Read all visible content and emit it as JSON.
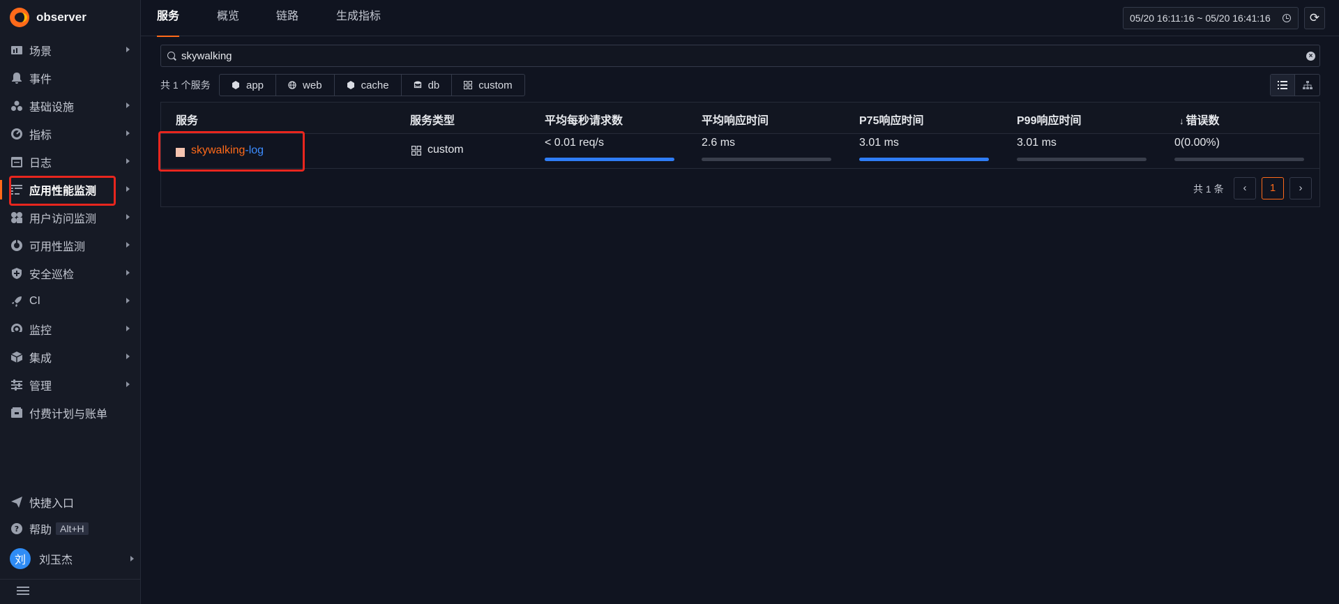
{
  "app": {
    "name": "observer"
  },
  "sidebar": {
    "items": [
      {
        "label": "场景",
        "icon": "dashboard-icon",
        "expandable": true
      },
      {
        "label": "事件",
        "icon": "bell-icon",
        "expandable": false
      },
      {
        "label": "基础设施",
        "icon": "infrastructure-icon",
        "expandable": true
      },
      {
        "label": "指标",
        "icon": "metrics-icon",
        "expandable": true
      },
      {
        "label": "日志",
        "icon": "log-icon",
        "expandable": true
      },
      {
        "label": "应用性能监测",
        "icon": "apm-icon",
        "expandable": true,
        "active": true
      },
      {
        "label": "用户访问监测",
        "icon": "rum-icon",
        "expandable": true
      },
      {
        "label": "可用性监测",
        "icon": "availability-icon",
        "expandable": true
      },
      {
        "label": "安全巡检",
        "icon": "shield-icon",
        "expandable": true
      },
      {
        "label": "CI",
        "icon": "rocket-icon",
        "expandable": true
      },
      {
        "label": "监控",
        "icon": "monitor-icon",
        "expandable": true
      },
      {
        "label": "集成",
        "icon": "integration-icon",
        "expandable": true
      },
      {
        "label": "管理",
        "icon": "settings-sliders-icon",
        "expandable": true
      },
      {
        "label": "付费计划与账单",
        "icon": "billing-icon",
        "expandable": false
      }
    ],
    "bottom": {
      "shortcut_label": "快捷入口",
      "help_label": "帮助",
      "help_shortcut": "Alt+H",
      "user_avatar": "刘",
      "user_name": "刘玉杰"
    }
  },
  "header": {
    "tabs": [
      "服务",
      "概览",
      "链路",
      "生成指标"
    ],
    "active_tab": "服务",
    "time_range": "05/20 16:11:16 ~ 05/20 16:41:16"
  },
  "search": {
    "value": "skywalking"
  },
  "filters": {
    "count_text": "共 1 个服务",
    "types": [
      {
        "label": "app",
        "icon": "app-icon"
      },
      {
        "label": "web",
        "icon": "globe-icon"
      },
      {
        "label": "cache",
        "icon": "cache-icon"
      },
      {
        "label": "db",
        "icon": "database-icon"
      },
      {
        "label": "custom",
        "icon": "custom-icon"
      }
    ]
  },
  "table": {
    "columns": [
      "服务",
      "服务类型",
      "平均每秒请求数",
      "平均响应时间",
      "P75响应时间",
      "P99响应时间",
      "错误数"
    ],
    "sort_indicator": "↓",
    "rows": [
      {
        "service_part1": "skywalking",
        "service_part2": "-log",
        "type": "custom",
        "avg_rps": "< 0.01 req/s",
        "avg_rps_bar": 1.0,
        "avg_resp": "2.6 ms",
        "avg_resp_bar": 0.0,
        "p75": "3.01 ms",
        "p75_bar": 1.0,
        "p99": "3.01 ms",
        "p99_bar": 0.0,
        "errors": "0(0.00%)",
        "errors_bar": 0.0
      }
    ],
    "pagination": {
      "total_text": "共 1 条",
      "current_page": "1"
    }
  },
  "colors": {
    "accent": "#ff6a1a",
    "link": "#3c8cff",
    "bar": "#2f7df6",
    "highlight_box": "#e8261e"
  }
}
